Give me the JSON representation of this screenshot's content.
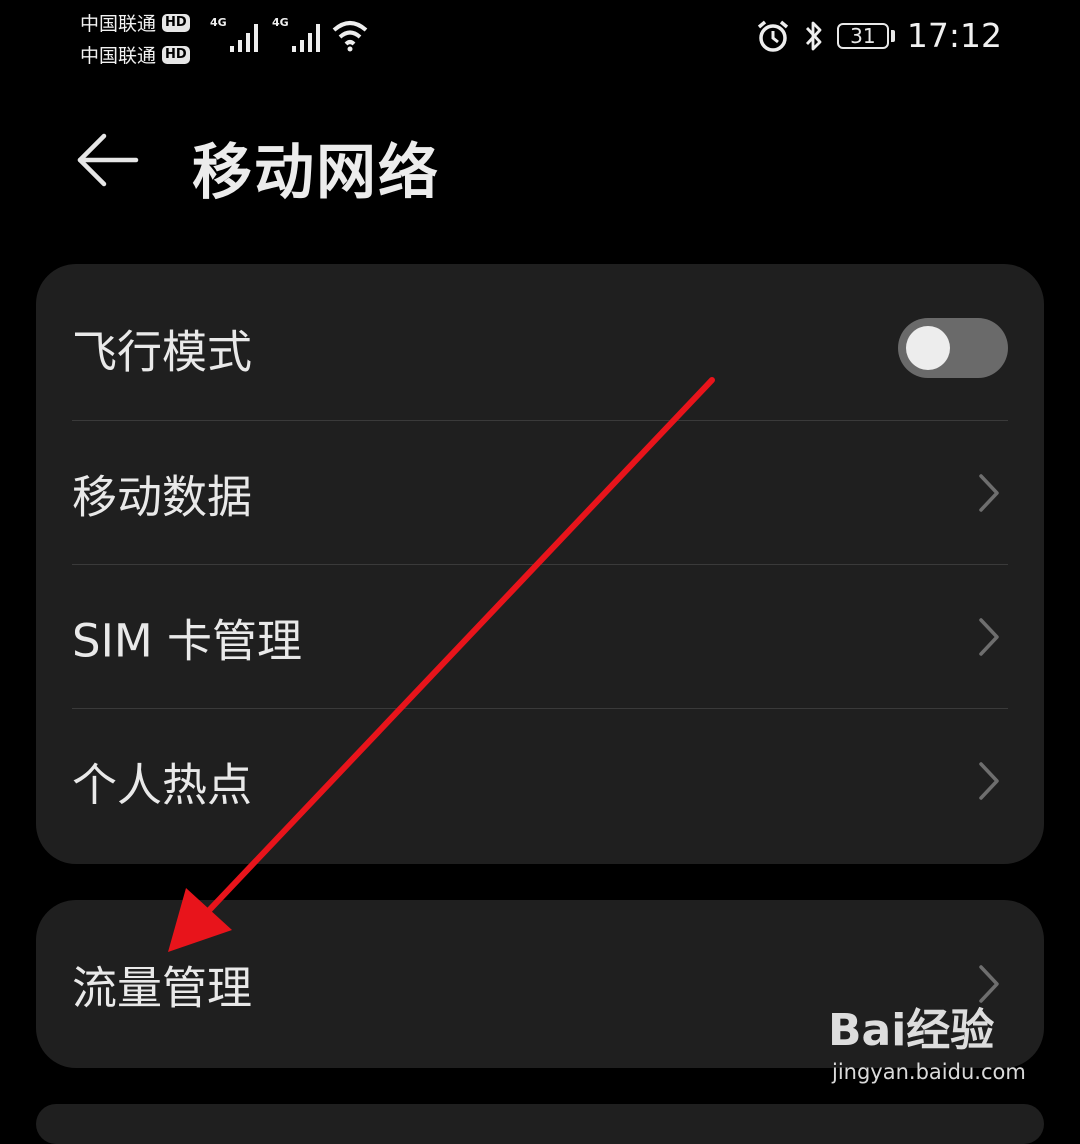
{
  "status_bar": {
    "carrier_1": "中国联通",
    "carrier_2": "中国联通",
    "hd_badge": "HD",
    "network_gen_1": "4G",
    "network_gen_2": "4G",
    "battery_level": "31",
    "time": "17:12",
    "icons": [
      "signal-icon",
      "signal-icon",
      "wifi-icon",
      "alarm-icon",
      "bluetooth-icon",
      "battery-icon"
    ]
  },
  "header": {
    "back_icon": "back-arrow-icon",
    "title": "移动网络"
  },
  "settings_group_1": {
    "items": [
      {
        "label": "飞行模式",
        "control": "toggle",
        "toggle_on": false
      },
      {
        "label": "移动数据",
        "control": "chevron"
      },
      {
        "label": "SIM 卡管理",
        "control": "chevron"
      },
      {
        "label": "个人热点",
        "control": "chevron"
      }
    ]
  },
  "settings_group_2": {
    "items": [
      {
        "label": "流量管理",
        "control": "chevron"
      }
    ]
  },
  "annotation": {
    "arrow_color": "#e8141b"
  },
  "watermark": {
    "logo_text": "Bai经验",
    "url": "jingyan.baidu.com"
  }
}
